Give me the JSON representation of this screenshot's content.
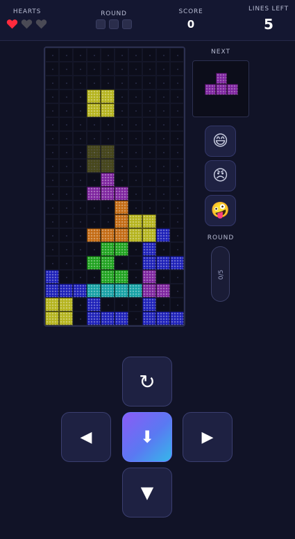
{
  "header": {
    "hearts_label": "HEARTS",
    "hearts": [
      {
        "state": "full",
        "color": "#ff2a3d"
      },
      {
        "state": "empty",
        "color": "#4a4a55"
      },
      {
        "state": "empty",
        "color": "#4a4a55"
      }
    ],
    "round_label": "ROUND",
    "round_boxes": 3,
    "score_label": "SCORE",
    "score_value": "0",
    "lines_label": "LINES LEFT",
    "lines_value": "5"
  },
  "board": {
    "columns": 10,
    "rows": 20,
    "colors": {
      "Y": "#b4b31c",
      "P": "#7d239e",
      "O": "#c36a12",
      "G": "#1ea21e",
      "B": "#1c1fb8",
      "C": "#15a0a4",
      "g": "#9a9a1a"
    },
    "grid": [
      "..........",
      "..........",
      "..........",
      "YY........",
      "YY........",
      "..........",
      "..........",
      "gg........",
      "gg........",
      ".P........",
      "PPP.......",
      "...O......",
      "...OYY....",
      "OOOOYY....",
      "....GG....",
      "...GGB....",
      "....GGGBBBB",
      "....GGBPB.",
      "B...GGPPP.",
      "BBB.CCCC..",
      "YY..B.B...",
      "YY..BBBB.BB"
    ]
  },
  "next": {
    "label": "NEXT",
    "piece_color": "#7d239e",
    "piece": [
      "..P",
      ".PPP"
    ]
  },
  "emoji_buttons": [
    {
      "name": "grin-emoji",
      "glyph": "😄"
    },
    {
      "name": "angry-emoji",
      "glyph": "😠"
    },
    {
      "name": "zany-emoji",
      "glyph": "🤪"
    }
  ],
  "round_panel": {
    "label": "ROUND",
    "progress_text": "0/5",
    "progress": 0
  },
  "controls": {
    "rotate": "↻",
    "left": "◀",
    "drop": "⬇",
    "right": "▶",
    "down": "▼"
  }
}
